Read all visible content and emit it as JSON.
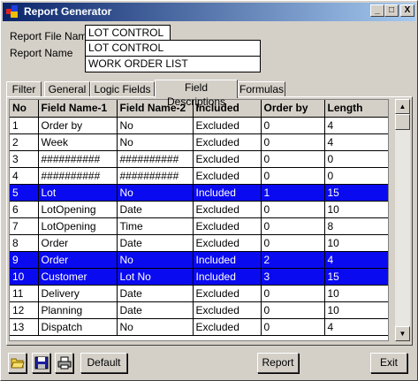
{
  "window": {
    "title": "Report Generator"
  },
  "title_buttons": {
    "minimize": "_",
    "maximize": "□",
    "close": "X"
  },
  "form": {
    "report_file_name_label": "Report File Name",
    "report_file_name": "LOT CONTROL",
    "report_name_label": "Report Name",
    "report_name_line1": "LOT CONTROL",
    "report_name_line2": "WORK ORDER LIST"
  },
  "tabs": [
    {
      "label": "Filter"
    },
    {
      "label": "General"
    },
    {
      "label": "Logic Fields"
    },
    {
      "label": "Field Descriptions",
      "active": true
    },
    {
      "label": "Formulas"
    }
  ],
  "grid": {
    "columns": [
      "No",
      "Field Name-1",
      "Field Name-2",
      "Included",
      "Order by",
      "Length"
    ],
    "rows": [
      {
        "cells": [
          "1",
          "Order by",
          "No",
          "Excluded",
          "0",
          "4"
        ],
        "selected": false
      },
      {
        "cells": [
          "2",
          "Week",
          "No",
          "Excluded",
          "0",
          "4"
        ],
        "selected": false
      },
      {
        "cells": [
          "3",
          "##########",
          "##########",
          "Excluded",
          "0",
          "0"
        ],
        "selected": false
      },
      {
        "cells": [
          "4",
          "##########",
          "##########",
          "Excluded",
          "0",
          "0"
        ],
        "selected": false
      },
      {
        "cells": [
          "5",
          "Lot",
          "No",
          "Included",
          "1",
          "15"
        ],
        "selected": true
      },
      {
        "cells": [
          "6",
          "LotOpening",
          "Date",
          "Excluded",
          "0",
          "10"
        ],
        "selected": false
      },
      {
        "cells": [
          "7",
          "LotOpening",
          "Time",
          "Excluded",
          "0",
          "8"
        ],
        "selected": false
      },
      {
        "cells": [
          "8",
          "Order",
          "Date",
          "Excluded",
          "0",
          "10"
        ],
        "selected": false
      },
      {
        "cells": [
          "9",
          "Order",
          "No",
          "Included",
          "2",
          "4"
        ],
        "selected": true
      },
      {
        "cells": [
          "10",
          "Customer",
          "Lot No",
          "Included",
          "3",
          "15"
        ],
        "selected": true
      },
      {
        "cells": [
          "11",
          "Delivery",
          "Date",
          "Excluded",
          "0",
          "10"
        ],
        "selected": false
      },
      {
        "cells": [
          "12",
          "Planning",
          "Date",
          "Excluded",
          "0",
          "10"
        ],
        "selected": false
      },
      {
        "cells": [
          "13",
          "Dispatch",
          "No",
          "Excluded",
          "0",
          "4"
        ],
        "selected": false
      }
    ]
  },
  "buttons": {
    "default_label": "Default",
    "report_label": "Report",
    "exit_label": "Exit"
  },
  "icons": {
    "open": "open-folder-icon",
    "save": "save-disk-icon",
    "print": "printer-icon"
  },
  "colors": {
    "selection": "#0a0af0",
    "titlebar": "#0a246a",
    "window_face": "#d4d0c8"
  }
}
